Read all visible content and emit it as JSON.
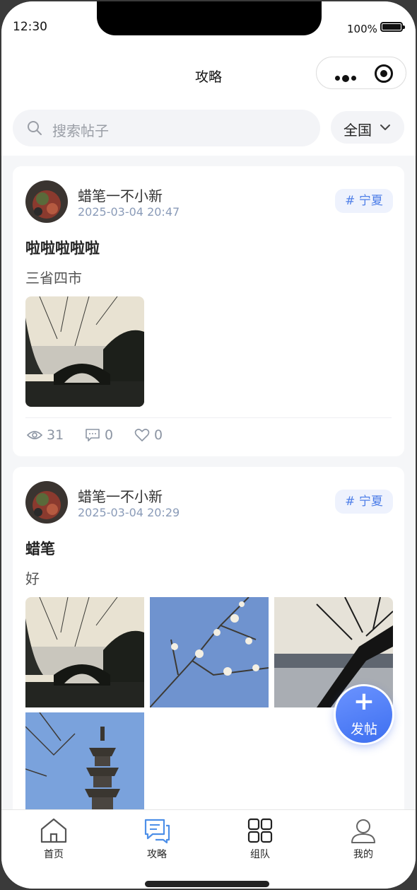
{
  "status_bar": {
    "time": "12:30",
    "battery": "100%"
  },
  "navbar": {
    "title": "攻略"
  },
  "search": {
    "placeholder": "搜索帖子",
    "region": "全国"
  },
  "posts": [
    {
      "author": "蜡笔一不小新",
      "time": "2025-03-04 20:47",
      "tag": "# 宁夏",
      "title": "啦啦啦啦啦",
      "content": "三省四市",
      "images": [
        "bridge-silhouette"
      ],
      "views": "31",
      "comments": "0",
      "likes": "0"
    },
    {
      "author": "蜡笔一不小新",
      "time": "2025-03-04 20:29",
      "tag": "# 宁夏",
      "title": "蜡笔",
      "content": "好",
      "images": [
        "bridge-silhouette",
        "magnolia-blossoms",
        "lake-tree-silhouette",
        "stone-pagoda"
      ]
    }
  ],
  "fab": {
    "icon": "plus-icon",
    "label": "发帖"
  },
  "tabbar": [
    {
      "label": "首页",
      "icon": "home-icon"
    },
    {
      "label": "攻略",
      "icon": "chat-icon",
      "active": true
    },
    {
      "label": "组队",
      "icon": "grid-icon"
    },
    {
      "label": "我的",
      "icon": "user-icon"
    }
  ],
  "colors": {
    "accent": "#4d7ee8",
    "tag_bg": "#eef2fd",
    "meta": "#8a9bb8",
    "page_bg": "#f5f6f8"
  }
}
